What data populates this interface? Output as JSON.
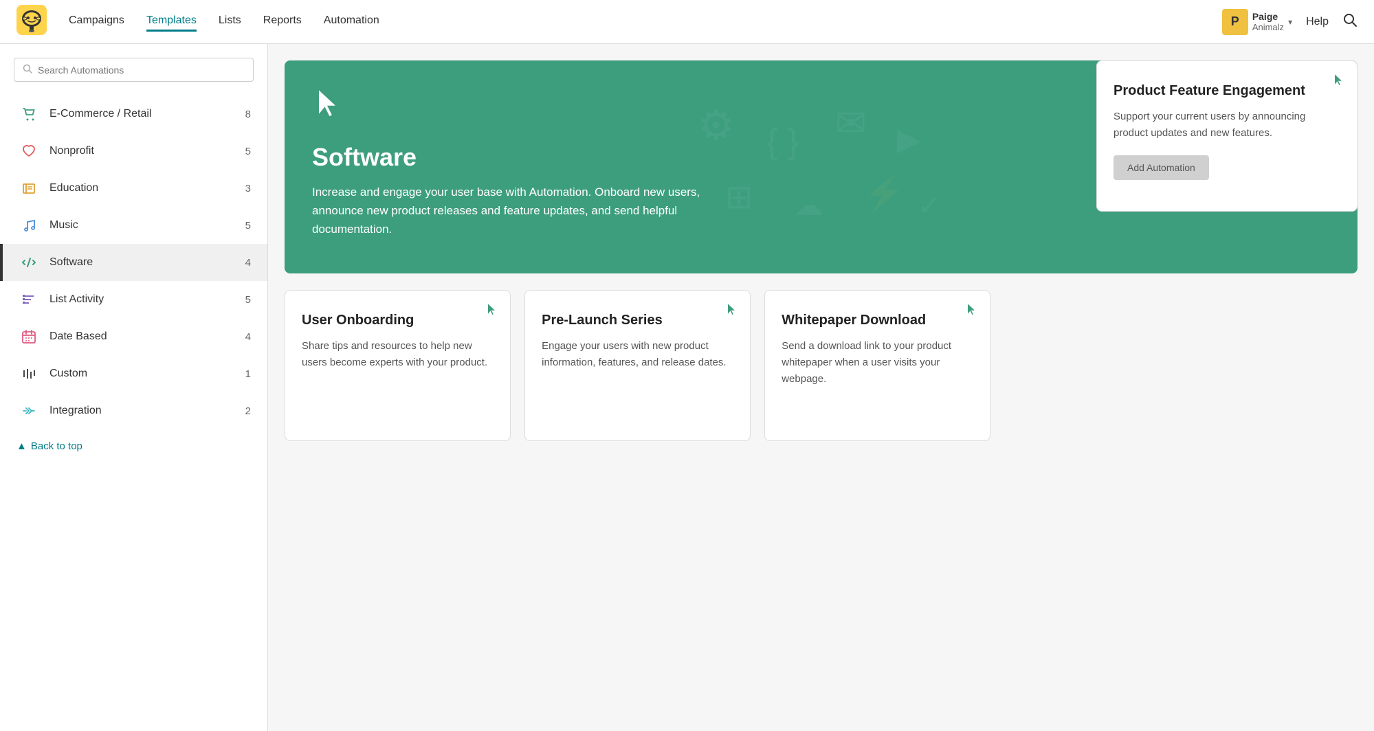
{
  "topnav": {
    "links": [
      {
        "id": "campaigns",
        "label": "Campaigns",
        "active": false
      },
      {
        "id": "templates",
        "label": "Templates",
        "active": false
      },
      {
        "id": "lists",
        "label": "Lists",
        "active": false
      },
      {
        "id": "reports",
        "label": "Reports",
        "active": false
      },
      {
        "id": "automation",
        "label": "Automation",
        "active": true
      }
    ],
    "user": {
      "initial": "P",
      "name": "Paige",
      "org": "Animalz"
    },
    "help_label": "Help"
  },
  "sidebar": {
    "search_placeholder": "Search Automations",
    "items": [
      {
        "id": "ecommerce",
        "label": "E-Commerce / Retail",
        "count": 8,
        "icon": "ecommerce"
      },
      {
        "id": "nonprofit",
        "label": "Nonprofit",
        "count": 5,
        "icon": "nonprofit"
      },
      {
        "id": "education",
        "label": "Education",
        "count": 3,
        "icon": "education"
      },
      {
        "id": "music",
        "label": "Music",
        "count": 5,
        "icon": "music"
      },
      {
        "id": "software",
        "label": "Software",
        "count": 4,
        "icon": "software",
        "active": true
      },
      {
        "id": "listactivity",
        "label": "List Activity",
        "count": 5,
        "icon": "listactivity"
      },
      {
        "id": "datebased",
        "label": "Date Based",
        "count": 4,
        "icon": "datebased"
      },
      {
        "id": "custom",
        "label": "Custom",
        "count": 1,
        "icon": "custom"
      },
      {
        "id": "integration",
        "label": "Integration",
        "count": 2,
        "icon": "integration"
      }
    ],
    "back_label": "Back to top"
  },
  "hero": {
    "title": "Software",
    "description": "Increase and engage your user base with Automation. Onboard new users, announce new product releases and feature updates, and send helpful documentation."
  },
  "cards": [
    {
      "id": "product-feature",
      "title": "Product Feature Engagement",
      "description": "Support your current users by announcing product updates and new features.",
      "btn_label": "Add Automation",
      "show_btn": true
    },
    {
      "id": "user-onboarding",
      "title": "User Onboarding",
      "description": "Share tips and resources to help new users become experts with your product.",
      "show_btn": false
    },
    {
      "id": "pre-launch",
      "title": "Pre-Launch Series",
      "description": "Engage your users with new product information, features, and release dates.",
      "show_btn": false
    },
    {
      "id": "whitepaper",
      "title": "Whitepaper Download",
      "description": "Send a download link to your product whitepaper when a user visits your webpage.",
      "show_btn": false
    }
  ]
}
